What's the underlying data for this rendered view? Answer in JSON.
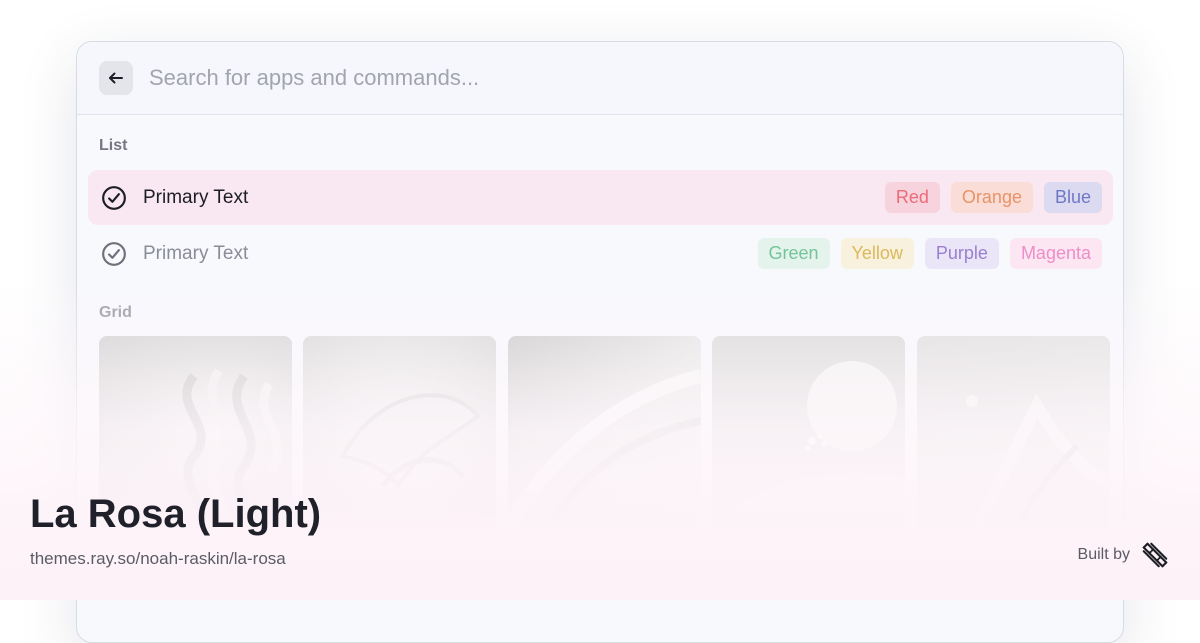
{
  "search": {
    "placeholder": "Search for apps and commands..."
  },
  "sections": {
    "list_label": "List",
    "grid_label": "Grid"
  },
  "list": [
    {
      "text": "Primary Text",
      "selected": true,
      "tags": [
        {
          "label": "Red",
          "color": "#ec6b78",
          "bg": "#f7d4dd"
        },
        {
          "label": "Orange",
          "color": "#e89367",
          "bg": "#f9ddd6"
        },
        {
          "label": "Blue",
          "color": "#6e78c6",
          "bg": "#dcdaf0"
        }
      ]
    },
    {
      "text": "Primary Text",
      "selected": false,
      "tags": [
        {
          "label": "Green",
          "color": "#73c599",
          "bg": "#e5f3ed"
        },
        {
          "label": "Yellow",
          "color": "#ddb85c",
          "bg": "#f7f1dd"
        },
        {
          "label": "Purple",
          "color": "#9a7fd0",
          "bg": "#ebe6f7"
        },
        {
          "label": "Magenta",
          "color": "#ee8ec8",
          "bg": "#fbe6f2"
        }
      ]
    }
  ],
  "grid_count": 5,
  "footer": {
    "title": "La Rosa (Light)",
    "url": "themes.ray.so/noah-raskin/la-rosa",
    "built_by": "Built by"
  },
  "colors": {
    "accent_row": "#f9e7f1",
    "text_primary": "#1d1d25",
    "text_secondary": "#767782"
  }
}
